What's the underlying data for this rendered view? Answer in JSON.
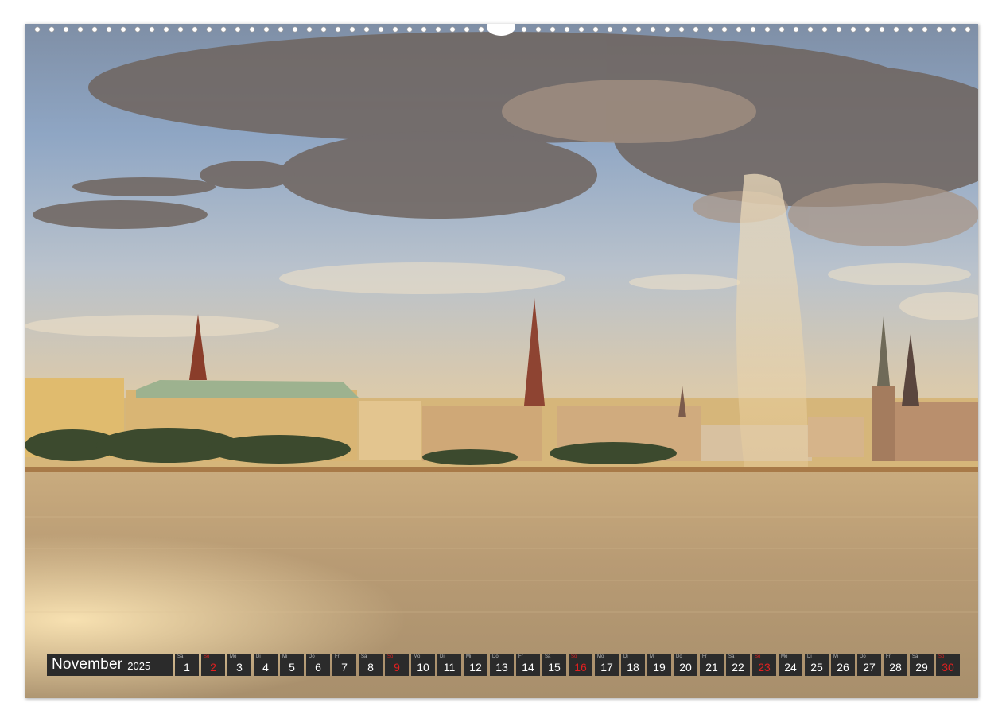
{
  "calendar": {
    "month": "November",
    "year": "2025",
    "days": [
      {
        "num": "1",
        "wd": "Sa",
        "sunday": false
      },
      {
        "num": "2",
        "wd": "So",
        "sunday": true
      },
      {
        "num": "3",
        "wd": "Mo",
        "sunday": false
      },
      {
        "num": "4",
        "wd": "Di",
        "sunday": false
      },
      {
        "num": "5",
        "wd": "Mi",
        "sunday": false
      },
      {
        "num": "6",
        "wd": "Do",
        "sunday": false
      },
      {
        "num": "7",
        "wd": "Fr",
        "sunday": false
      },
      {
        "num": "8",
        "wd": "Sa",
        "sunday": false
      },
      {
        "num": "9",
        "wd": "So",
        "sunday": true
      },
      {
        "num": "10",
        "wd": "Mo",
        "sunday": false
      },
      {
        "num": "11",
        "wd": "Di",
        "sunday": false
      },
      {
        "num": "12",
        "wd": "Mi",
        "sunday": false
      },
      {
        "num": "13",
        "wd": "Do",
        "sunday": false
      },
      {
        "num": "14",
        "wd": "Fr",
        "sunday": false
      },
      {
        "num": "15",
        "wd": "Sa",
        "sunday": false
      },
      {
        "num": "16",
        "wd": "So",
        "sunday": true
      },
      {
        "num": "17",
        "wd": "Mo",
        "sunday": false
      },
      {
        "num": "18",
        "wd": "Di",
        "sunday": false
      },
      {
        "num": "19",
        "wd": "Mi",
        "sunday": false
      },
      {
        "num": "20",
        "wd": "Do",
        "sunday": false
      },
      {
        "num": "21",
        "wd": "Fr",
        "sunday": false
      },
      {
        "num": "22",
        "wd": "Sa",
        "sunday": false
      },
      {
        "num": "23",
        "wd": "So",
        "sunday": true
      },
      {
        "num": "24",
        "wd": "Mo",
        "sunday": false
      },
      {
        "num": "25",
        "wd": "Di",
        "sunday": false
      },
      {
        "num": "26",
        "wd": "Mi",
        "sunday": false
      },
      {
        "num": "27",
        "wd": "Do",
        "sunday": false
      },
      {
        "num": "28",
        "wd": "Fr",
        "sunday": false
      },
      {
        "num": "29",
        "wd": "Sa",
        "sunday": false
      },
      {
        "num": "30",
        "wd": "So",
        "sunday": true
      }
    ]
  },
  "colors": {
    "bar_bg": "#2b2b2b",
    "sunday": "#e02020",
    "text": "#ffffff"
  }
}
